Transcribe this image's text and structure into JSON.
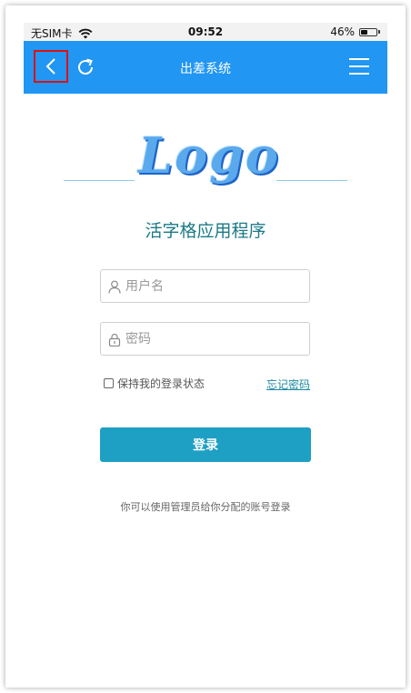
{
  "status_bar": {
    "carrier": "无SIM卡",
    "time": "09:52",
    "battery_text": "46%",
    "battery_level": 0.46
  },
  "nav": {
    "title": "出差系统",
    "bar_color": "#2196F3"
  },
  "logo": {
    "text": "Logo"
  },
  "app_name": "活字格应用程序",
  "form": {
    "username_placeholder": "用户名",
    "password_placeholder": "密码",
    "remember_label": "保持我的登录状态",
    "remember_checked": false,
    "forgot_label": "忘记密码",
    "login_label": "登录",
    "login_color": "#1e9fc4"
  },
  "hint": "你可以使用管理员给你分配的账号登录"
}
